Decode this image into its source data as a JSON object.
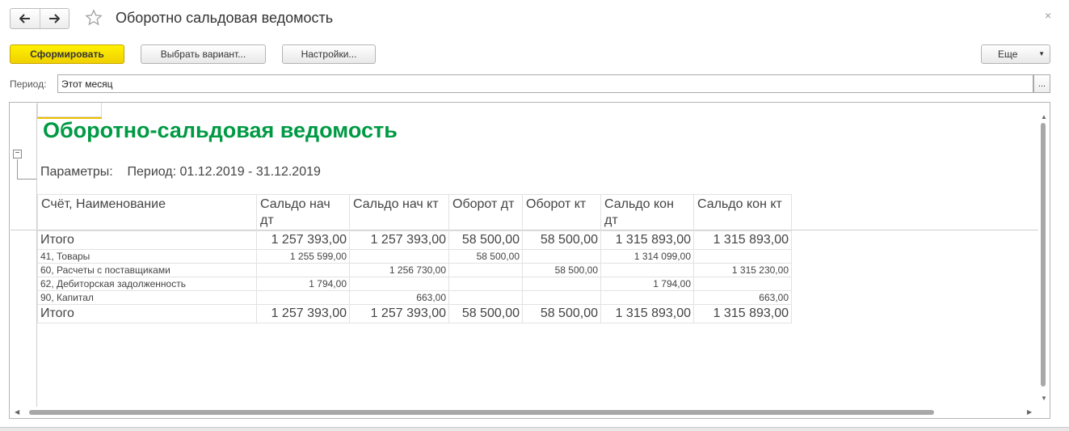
{
  "window": {
    "title": "Оборотно сальдовая ведомость",
    "back_icon": "arrow-left-icon",
    "forward_icon": "arrow-right-icon",
    "favorite_icon": "star-icon",
    "close_glyph": "×"
  },
  "toolbar": {
    "generate_label": "Сформировать",
    "choose_variant_label": "Выбрать вариант...",
    "settings_label": "Настройки...",
    "more_label": "Еще",
    "accent_color": "#f5dc00"
  },
  "period": {
    "label": "Период:",
    "value": "Этот месяц",
    "choose_label": "..."
  },
  "report": {
    "title": "Оборотно-сальдовая ведомость",
    "title_color": "#009a44",
    "parameters_label": "Параметры:",
    "parameters_value": "Период: 01.12.2019 - 31.12.2019",
    "group_toggle": "−",
    "columns": [
      "Счёт, Наименование",
      "Сальдо нач дт",
      "Сальдо нач кт",
      "Оборот дт",
      "Оборот кт",
      "Сальдо кон дт",
      "Сальдо кон кт"
    ],
    "total_top": [
      "Итого",
      "1 257 393,00",
      "1 257 393,00",
      "58 500,00",
      "58 500,00",
      "1 315 893,00",
      "1 315 893,00"
    ],
    "rows": [
      [
        "41, Товары",
        "1 255 599,00",
        "",
        "58 500,00",
        "",
        "1 314 099,00",
        ""
      ],
      [
        "60, Расчеты с поставщиками",
        "",
        "1 256 730,00",
        "",
        "58 500,00",
        "",
        "1 315 230,00"
      ],
      [
        "62, Дебиторская задолженность",
        "1 794,00",
        "",
        "",
        "",
        "1 794,00",
        ""
      ],
      [
        "90, Капитал",
        "",
        "663,00",
        "",
        "",
        "",
        "663,00"
      ]
    ],
    "total_bottom": [
      "Итого",
      "1 257 393,00",
      "1 257 393,00",
      "58 500,00",
      "58 500,00",
      "1 315 893,00",
      "1 315 893,00"
    ]
  }
}
